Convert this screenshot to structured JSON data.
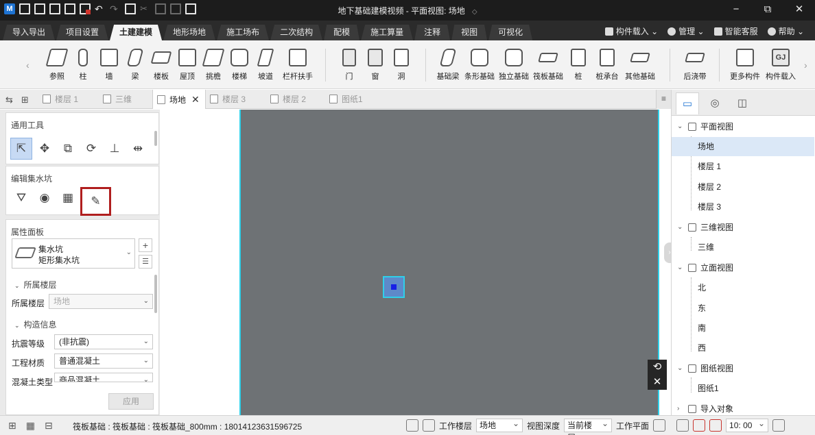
{
  "window": {
    "title": "地下基础建模视频 - 平面视图: 场地",
    "controls": [
      "−",
      "⧉",
      "✕"
    ]
  },
  "menu": {
    "tabs": [
      "导入导出",
      "项目设置",
      "土建建模",
      "地形场地",
      "施工场布",
      "二次结构",
      "配模",
      "施工算量",
      "注释",
      "视图",
      "可视化"
    ],
    "active_tab": "土建建模",
    "right": {
      "component_load": "构件载入",
      "manage": "管理",
      "service": "智能客服",
      "help": "帮助"
    }
  },
  "ribbon": {
    "group1": [
      "参照",
      "柱",
      "墙",
      "梁",
      "楼板",
      "屋顶",
      "挑檐",
      "楼梯",
      "坡道",
      "栏杆扶手"
    ],
    "group2": [
      "门",
      "窗",
      "洞"
    ],
    "group3": [
      "基础梁",
      "条形基础",
      "独立基础",
      "筏板基础",
      "桩",
      "桩承台",
      "其他基础"
    ],
    "group4": [
      "后浇带"
    ],
    "group5": [
      "更多构件",
      "构件载入"
    ],
    "gj_badge": "GJ"
  },
  "doc_tabs": {
    "items": [
      {
        "label": "楼层 1",
        "active": false
      },
      {
        "label": "三维",
        "active": false
      },
      {
        "label": "场地",
        "active": true
      },
      {
        "label": "楼层 3",
        "active": false
      },
      {
        "label": "楼层 2",
        "active": false
      },
      {
        "label": "图纸1",
        "active": false
      }
    ],
    "close": "✕",
    "menu": "≡"
  },
  "left_panel": {
    "general_tools_title": "通用工具",
    "edit_title": "编辑集水坑",
    "properties_title": "属性面板",
    "component": {
      "line1": "集水坑",
      "line2": "矩形集水坑"
    },
    "section_floor": "所属楼层",
    "floor_label": "所属楼层",
    "floor_value": "场地",
    "section_construct": "构造信息",
    "fields": [
      {
        "label": "抗震等级",
        "value": "(非抗震)"
      },
      {
        "label": "工程材质",
        "value": "普通混凝土"
      },
      {
        "label": "混凝土类型",
        "value": "商品混凝土"
      }
    ],
    "apply": "应用",
    "add": "+",
    "list": "☰"
  },
  "right_panel": {
    "tree": [
      {
        "label": "平面视图",
        "level": 0
      },
      {
        "label": "场地",
        "level": 1,
        "selected": true
      },
      {
        "label": "楼层 1",
        "level": 1
      },
      {
        "label": "楼层 2",
        "level": 1
      },
      {
        "label": "楼层 3",
        "level": 1
      },
      {
        "label": "三维视图",
        "level": 0
      },
      {
        "label": "三维",
        "level": 1
      },
      {
        "label": "立面视图",
        "level": 0
      },
      {
        "label": "北",
        "level": 1
      },
      {
        "label": "东",
        "level": 1
      },
      {
        "label": "南",
        "level": 1
      },
      {
        "label": "西",
        "level": 1
      },
      {
        "label": "图纸视图",
        "level": 0
      },
      {
        "label": "图纸1",
        "level": 1
      },
      {
        "label": "导入对象",
        "level": 0
      }
    ]
  },
  "status": {
    "selection": "筏板基础 : 筏板基础 : 筏板基础_800mm : 18014123631596725",
    "work_floor_label": "工作楼层",
    "work_floor": "场地",
    "view_depth_label": "视图深度",
    "view_depth": "当前楼层",
    "work_plane_label": "工作平面",
    "time": "10: 00"
  },
  "colors": {
    "titlebar": "#1c1c1c",
    "canvas": "#6e7275",
    "canvas_border": "#2fd0ea",
    "pile_fill": "#5e89c9",
    "pile_core": "#1820e6",
    "highlight_box": "#b01e1e",
    "tree_selected": "#dbe8f7"
  }
}
